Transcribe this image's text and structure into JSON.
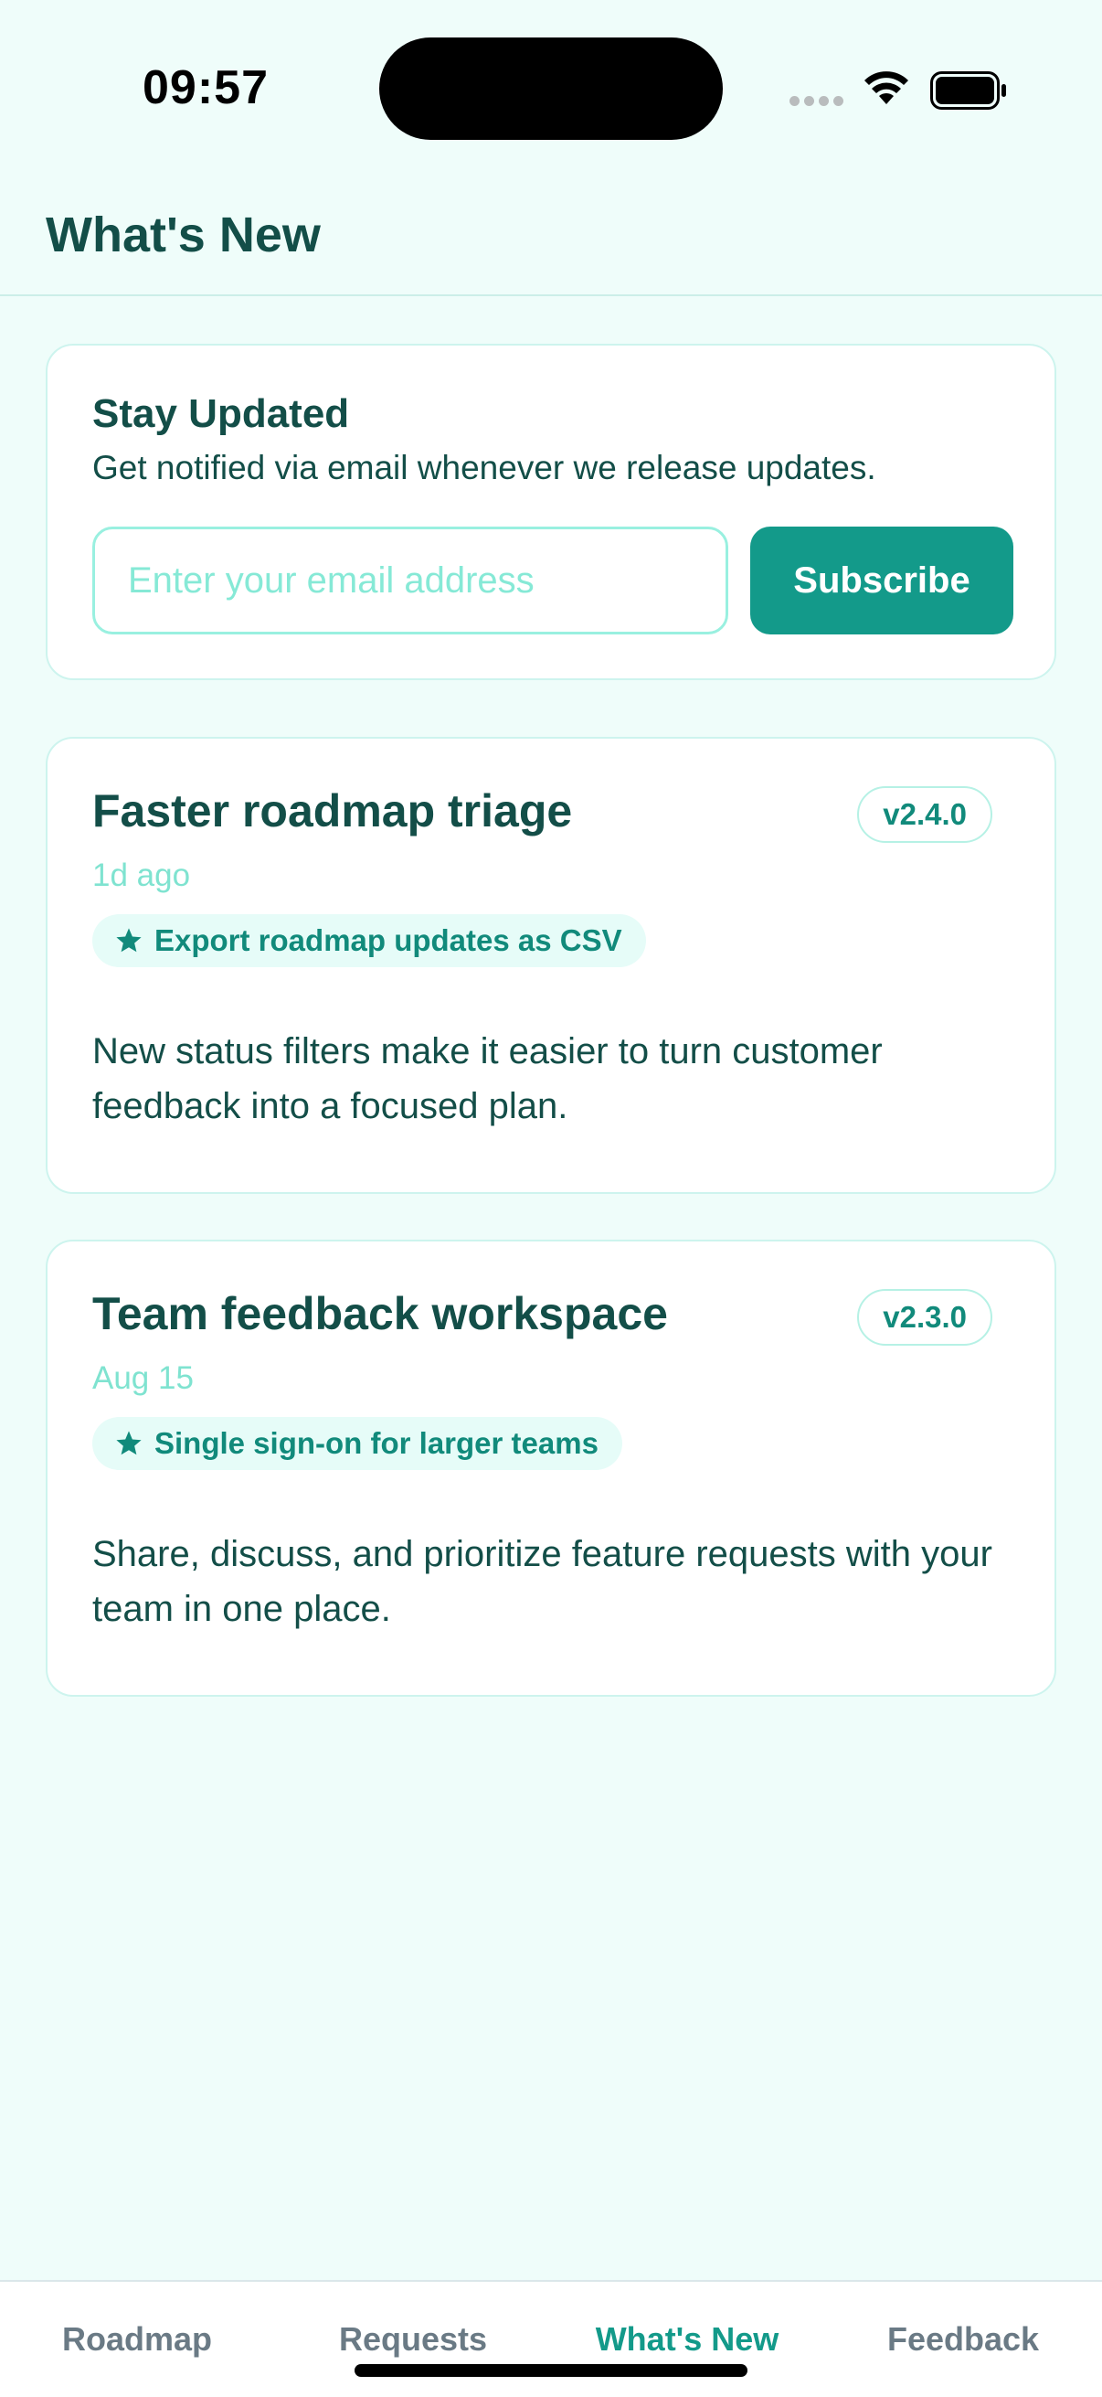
{
  "status_bar": {
    "time": "09:57",
    "icons": [
      "cellular-dots-icon",
      "wifi-icon",
      "battery-icon"
    ]
  },
  "header": {
    "title": "What's New"
  },
  "subscribe": {
    "title": "Stay Updated",
    "description": "Get notified via email whenever we release updates.",
    "email_placeholder": "Enter your email address",
    "email_value": "",
    "button_label": "Subscribe"
  },
  "releases": [
    {
      "title": "Faster roadmap triage",
      "version": "v2.4.0",
      "date": "1d ago",
      "feature": "Export roadmap updates as CSV",
      "feature_icon": "star-icon",
      "description": "New status filters make it easier to turn customer feedback into a focused plan."
    },
    {
      "title": "Team feedback workspace",
      "version": "v2.3.0",
      "date": "Aug 15",
      "feature": "Single sign-on for larger teams",
      "feature_icon": "star-icon",
      "description": "Share, discuss, and prioritize feature requests with your team in one place."
    }
  ],
  "tabs": [
    {
      "label": "Roadmap",
      "active": false
    },
    {
      "label": "Requests",
      "active": false
    },
    {
      "label": "What's New",
      "active": true
    },
    {
      "label": "Feedback",
      "active": false
    }
  ],
  "colors": {
    "background": "#effdfa",
    "accent": "#139a8a",
    "text": "#134e48",
    "muted": "#7fe3d0"
  }
}
